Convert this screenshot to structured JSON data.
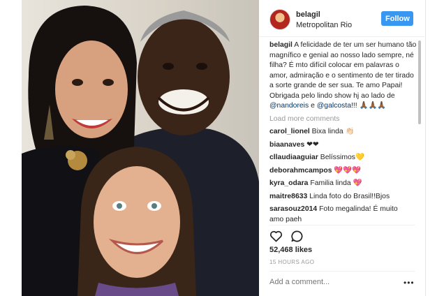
{
  "post": {
    "username": "belagil",
    "location": "Metropolitan Rio",
    "follow_label": "Follow",
    "caption_user": "belagil",
    "caption_text": "A felicidade de ter um ser humano tão magnífico e genial ao nosso lado sempre, né filha? É mto difícil colocar em palavras o amor, admiração e o sentimento de ter tirado a sorte grande de ser sua. Te amo Papai! Obrigada pelo lindo show hj ao lado de",
    "mention1": "@nandoreis",
    "caption_and": "e",
    "mention2": "@galcosta",
    "caption_end": "!!! 🙏🏾🙏🏾🙏🏾",
    "load_more": "Load more comments",
    "comments": [
      {
        "user": "carol_lionel",
        "text": "Bixa linda 👏🏻"
      },
      {
        "user": "biaanaves",
        "text": "❤❤"
      },
      {
        "user": "cllaudiaaguiar",
        "text": "Belíssimos💛"
      },
      {
        "user": "deborahmcampos",
        "text": "💖💖💖"
      },
      {
        "user": "kyra_odara",
        "text": "Familia linda 💖"
      },
      {
        "user": "maitre8633",
        "text": "Linda foto do Brasil!!Bjos"
      },
      {
        "user": "sarasouz2014",
        "text": "Foto megalinda! É muito"
      },
      {
        "user": "",
        "text": "amo paeh"
      }
    ],
    "likes": "52,468 likes",
    "time_ago": "15 HOURS AGO",
    "add_comment_placeholder": "Add a comment...",
    "more_options": "•••"
  },
  "colors": {
    "accent": "#3897f0",
    "text": "#262626",
    "muted": "#999999",
    "mention": "#003569"
  },
  "icons": [
    "heart-icon",
    "comment-icon",
    "more-options-icon"
  ]
}
